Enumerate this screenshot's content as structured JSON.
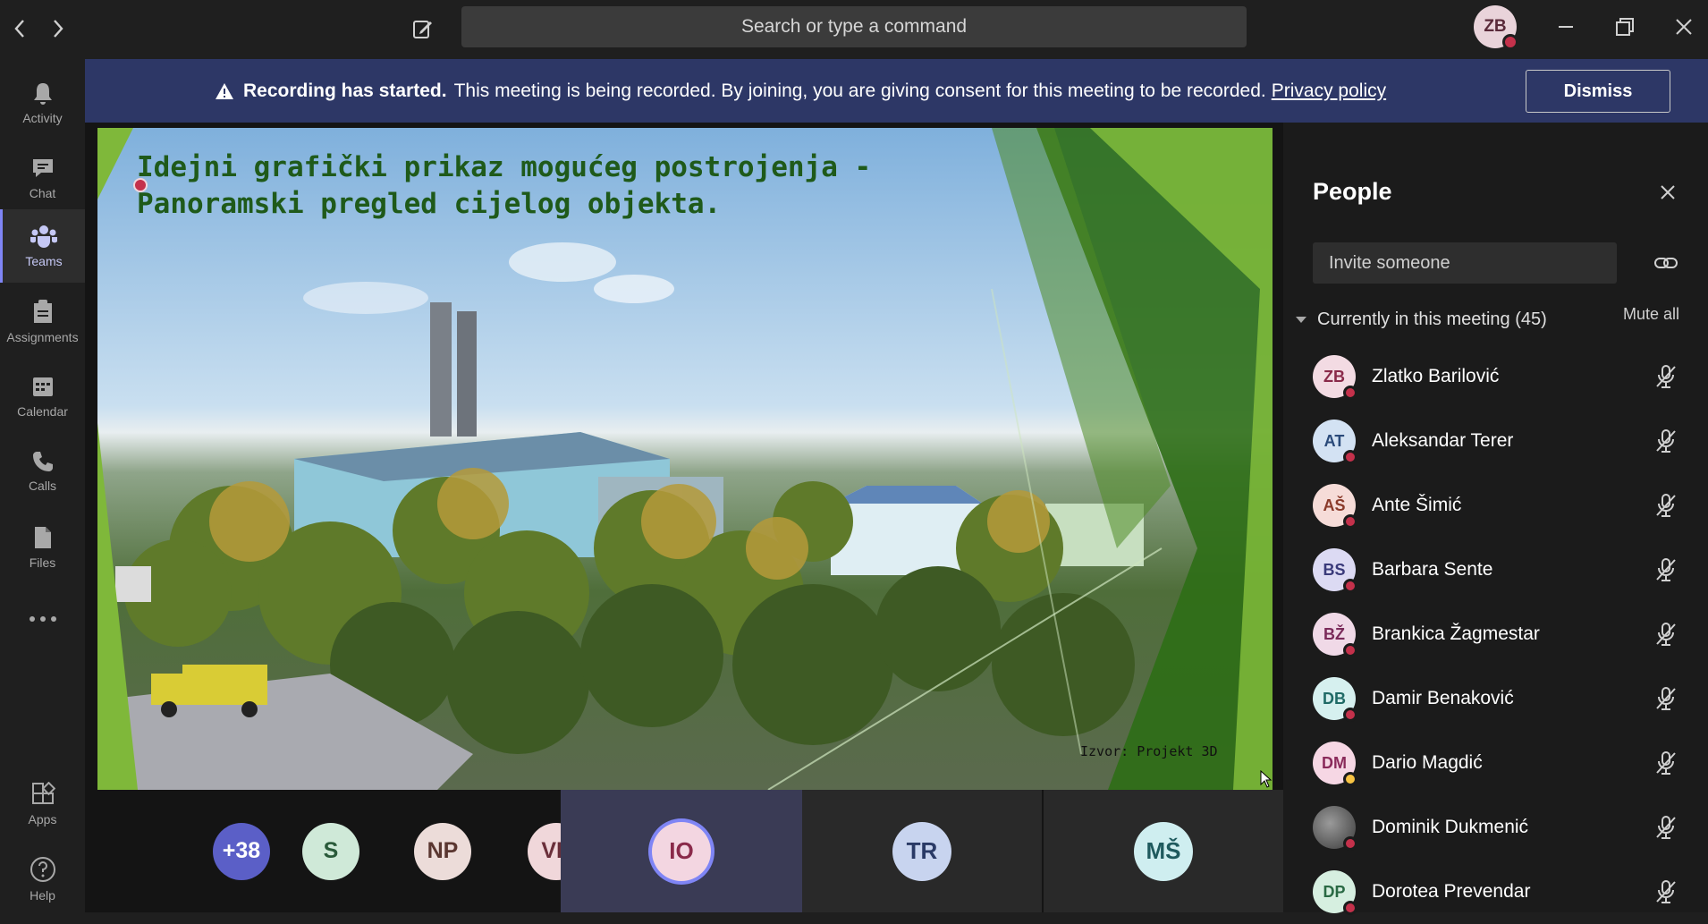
{
  "titlebar": {
    "search_placeholder": "Search or type a command",
    "user_initials": "ZB"
  },
  "rail": {
    "items": [
      {
        "label": "Activity",
        "icon": "bell-icon"
      },
      {
        "label": "Chat",
        "icon": "chat-icon"
      },
      {
        "label": "Teams",
        "icon": "teams-icon",
        "active": true
      },
      {
        "label": "Assignments",
        "icon": "assignments-icon"
      },
      {
        "label": "Calendar",
        "icon": "calendar-icon"
      },
      {
        "label": "Calls",
        "icon": "phone-icon"
      },
      {
        "label": "Files",
        "icon": "files-icon"
      },
      {
        "label": "Apps",
        "icon": "apps-icon"
      },
      {
        "label": "Help",
        "icon": "help-icon"
      }
    ]
  },
  "banner": {
    "bold_text": "Recording has started.",
    "text": "This meeting is being recorded. By joining, you are giving consent for this meeting to be recorded.",
    "link": "Privacy policy",
    "dismiss_label": "Dismiss"
  },
  "slide": {
    "title": "Idejni grafički prikaz mogućeg postrojenja - Panoramski pregled cijelog objekta.",
    "credit": "Izvor: Projekt 3D"
  },
  "strip": [
    {
      "initials": "+38",
      "bg": "#5b5fc7",
      "fg": "#ffffff"
    },
    {
      "initials": "S",
      "bg": "#cfe9d8",
      "fg": "#2a5a3a"
    },
    {
      "initials": "NP",
      "bg": "#ecdcd9",
      "fg": "#5a3630"
    },
    {
      "initials": "VP",
      "bg": "#f0d7da",
      "fg": "#6a2f3a"
    },
    {
      "initials": "IO",
      "bg": "#f3d6e1",
      "fg": "#8a2a4a"
    },
    {
      "initials": "TR",
      "bg": "#c8d4ef",
      "fg": "#2a3a66"
    },
    {
      "initials": "MŠ",
      "bg": "#cfeef0",
      "fg": "#1f5a5e"
    }
  ],
  "people": {
    "title": "People",
    "invite_placeholder": "Invite someone",
    "section_label": "Currently in this meeting (45)",
    "mute_all_label": "Mute all",
    "members": [
      {
        "initials": "ZB",
        "name": "Zlatko Barilović",
        "bg": "#f3dbe3",
        "fg": "#8a2a4a",
        "status": "#c4314b"
      },
      {
        "initials": "AT",
        "name": "Aleksandar Terer",
        "bg": "#d3e2f3",
        "fg": "#2a4a7a",
        "status": "#c4314b"
      },
      {
        "initials": "AŠ",
        "name": "Ante Šimić",
        "bg": "#f6dcd8",
        "fg": "#8a3a2a",
        "status": "#c4314b"
      },
      {
        "initials": "BS",
        "name": "Barbara Sente",
        "bg": "#dcdaf3",
        "fg": "#3a3a7a",
        "status": "#c4314b"
      },
      {
        "initials": "BŽ",
        "name": "Brankica Žagmestar",
        "bg": "#f0d9e7",
        "fg": "#7a2a5a",
        "status": "#c4314b"
      },
      {
        "initials": "DB",
        "name": "Damir Benaković",
        "bg": "#d6f0ef",
        "fg": "#1f6a66",
        "status": "#c4314b"
      },
      {
        "initials": "DM",
        "name": "Dario Magdić",
        "bg": "#f6d7e4",
        "fg": "#8a2a5a",
        "status": "#f8c444"
      },
      {
        "initials": "",
        "name": "Dominik Dukmenić",
        "bg": "#6b6b6b",
        "fg": "#ffffff",
        "status": "#c4314b",
        "photo": true
      },
      {
        "initials": "DP",
        "name": "Dorotea Prevendar",
        "bg": "#d6efe0",
        "fg": "#2a6a44",
        "status": "#c4314b"
      }
    ]
  }
}
